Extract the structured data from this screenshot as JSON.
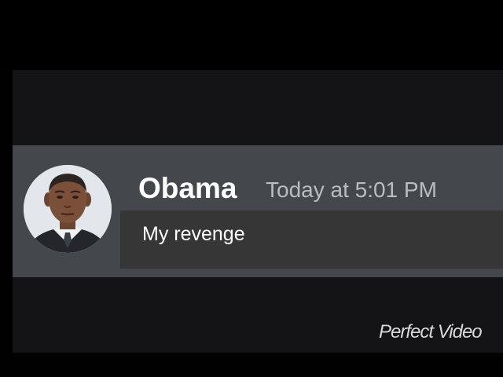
{
  "message": {
    "author": "Obama",
    "timestamp": "Today at 5:01 PM",
    "text": "My revenge",
    "avatar_icon": "user-avatar-photo"
  },
  "watermark": {
    "text": "Perfect Video"
  },
  "colors": {
    "background": "#141316",
    "message_row": "#44474c",
    "message_box": "#363636",
    "author": "#ffffff",
    "timestamp": "#b9bcc1"
  }
}
